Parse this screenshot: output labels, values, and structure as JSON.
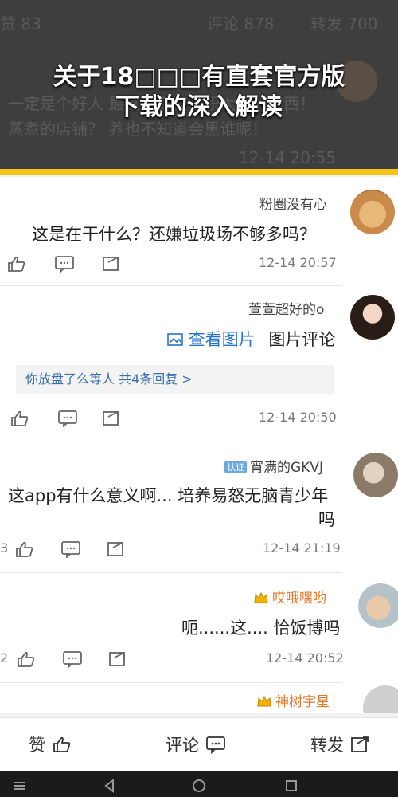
{
  "banner": {
    "title_line1": "关于18□□□有直套官方版",
    "title_line2": "下载的深入解读",
    "bg_tabs": [
      "赞 83",
      "评论 878",
      "转发 700"
    ],
    "bg_line1": "一定是个好人 最近一直在囤积大量的东西！",
    "bg_line2": "蒸煮的店铺？ 养也不知道会黑谁呢！",
    "bg_time": "12-14 20:55"
  },
  "comments": [
    {
      "username": "粉圈没有心",
      "text": "这是在干什么？还嫌垃圾场不够多吗？",
      "time": "12-14 20:57",
      "like": "",
      "avatar": "cat-avatar"
    },
    {
      "username": "萱萱超好的o",
      "text_prefix": "图片评论",
      "text_link": "查看图片",
      "reply": "你放盘了么等人 共4条回复 >",
      "time": "12-14 20:50",
      "avatar": "girl-avatar"
    },
    {
      "username": "宵满的GKVJ",
      "badge": "认证",
      "text": "这app有什么意义啊... 培养易怒无脑青少年",
      "text2": "吗",
      "time": "12-14 21:19",
      "like": "3",
      "avatar": "person-avatar"
    },
    {
      "username": "哎哦嘿哟",
      "text": "呃......这.... 恰饭博吗",
      "time": "12-14 20:52",
      "like": "2",
      "avatar": "hand-avatar"
    },
    {
      "username": "神树宇星",
      "avatar": "gray-avatar"
    }
  ],
  "bottombar": {
    "forward": "转发",
    "comment": "评论",
    "like": "赞"
  },
  "colors": {
    "accent_yellow": "#f5c518",
    "link_blue": "#2a72c8",
    "orange_name": "#e07a2a"
  }
}
